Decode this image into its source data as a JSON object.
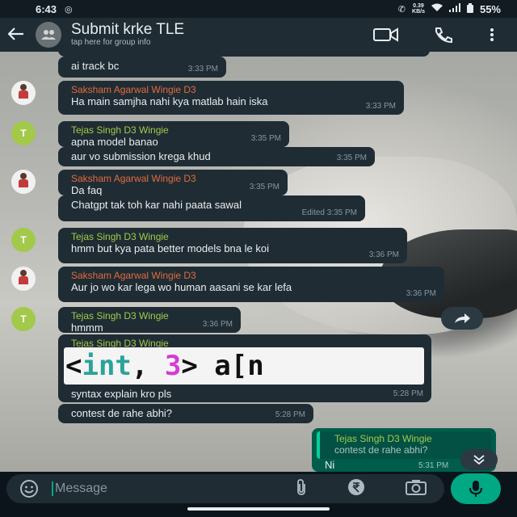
{
  "status_bar": {
    "time": "6:43",
    "net_speed_value": "0.39",
    "net_speed_unit": "KB/s",
    "battery": "55%"
  },
  "header": {
    "title": "Submit krke TLE",
    "subtitle": "tap here for group info",
    "icons": [
      "back-arrow-icon",
      "group-avatar-icon",
      "video-call-icon",
      "voice-call-icon",
      "more-options-icon"
    ]
  },
  "messages": [
    {
      "text": "ai track bc",
      "time": "3:33 PM"
    },
    {
      "sender": "Saksham Agarwal Wingie D3",
      "text": "Ha main samjha nahi kya matlab hain iska",
      "time": "3:33 PM"
    },
    {
      "sender": "Tejas Singh D3 Wingie",
      "avatar_letter": "T",
      "text": "apna model banao",
      "time": "3:35 PM"
    },
    {
      "text": "aur vo submission krega khud",
      "time": "3:35 PM"
    },
    {
      "sender": "Saksham Agarwal Wingie D3",
      "text": "Da faq",
      "time": "3:35 PM"
    },
    {
      "text": "Chatgpt tak toh kar nahi paata sawal",
      "time": "Edited 3:35 PM"
    },
    {
      "sender": "Tejas Singh D3 Wingie",
      "avatar_letter": "T",
      "text": "hmm but kya pata better models bna le koi",
      "time": "3:36 PM"
    },
    {
      "sender": "Saksham Agarwal Wingie D3",
      "text": "Aur jo wo kar lega wo human aasani se kar lefa",
      "time": "3:36 PM"
    },
    {
      "sender": "Tejas Singh D3 Wingie",
      "avatar_letter": "T",
      "text": "hmmm",
      "time": "3:36 PM"
    },
    {
      "sender": "Tejas Singh D3 Wingie",
      "image_text": {
        "open": "<",
        "keyword": "int",
        "comma": ", ",
        "number": "3",
        "rest": "> a[n"
      },
      "text": "syntax explain kro pls",
      "time": "5:28 PM"
    },
    {
      "text": "contest de rahe abhi?",
      "time": "5:28 PM"
    }
  ],
  "outgoing": {
    "quote_sender": "Tejas Singh D3 Wingie",
    "quote_text": "contest de rahe abhi?",
    "text": "Ni",
    "time": "5:31 PM"
  },
  "composer": {
    "placeholder": "Message",
    "icons": [
      "emoji-icon",
      "attach-icon",
      "rupee-icon",
      "camera-icon",
      "mic-icon"
    ]
  },
  "colors": {
    "header_bg": "#1f2c34",
    "bubble_in": "#1f2c34",
    "bubble_out": "#005c4b",
    "accent": "#00a884",
    "sender_orange": "#e26b3c",
    "sender_green": "#a3c94a"
  }
}
